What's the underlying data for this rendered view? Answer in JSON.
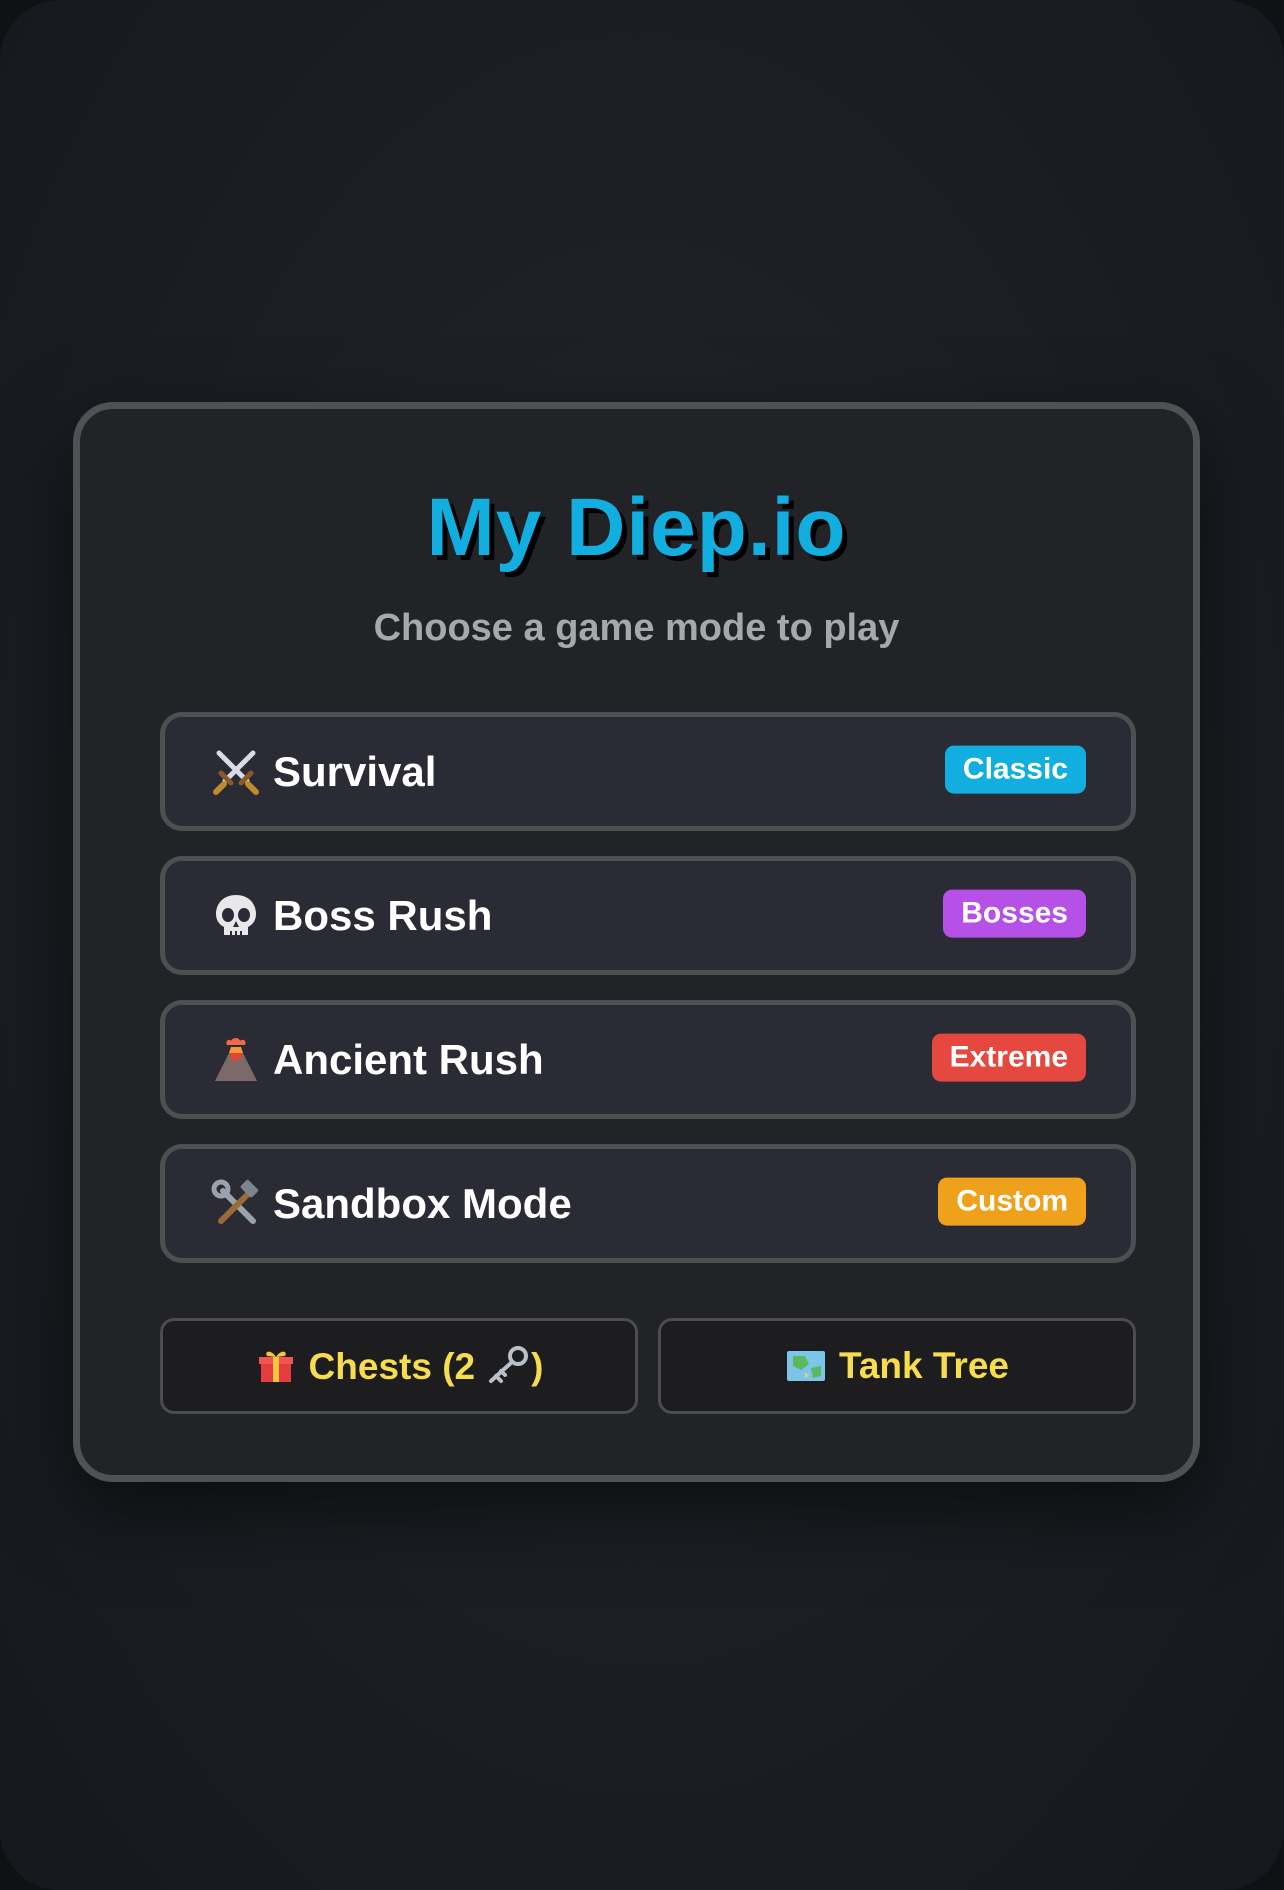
{
  "app": {
    "title": "My Diep.io",
    "subtitle": "Choose a game mode to play"
  },
  "modes": [
    {
      "label": "Survival",
      "tag": "Classic",
      "tag_color": "#12aedf",
      "icon": "crossed-swords-icon"
    },
    {
      "label": "Boss Rush",
      "tag": "Bosses",
      "tag_color": "#b650e6",
      "icon": "skull-icon"
    },
    {
      "label": "Ancient Rush",
      "tag": "Extreme",
      "tag_color": "#e4483f",
      "icon": "volcano-icon"
    },
    {
      "label": "Sandbox Mode",
      "tag": "Custom",
      "tag_color": "#f0a11c",
      "icon": "hammer-wrench-icon"
    }
  ],
  "actions": {
    "chests": {
      "label_prefix": "Chests (2",
      "label_suffix": ")",
      "icon": "gift-icon",
      "key_icon": "key-icon"
    },
    "tank_tree": {
      "label": "Tank Tree",
      "icon": "map-icon"
    }
  },
  "colors": {
    "title": "#13aee0",
    "action_text": "#f7dc4f"
  }
}
